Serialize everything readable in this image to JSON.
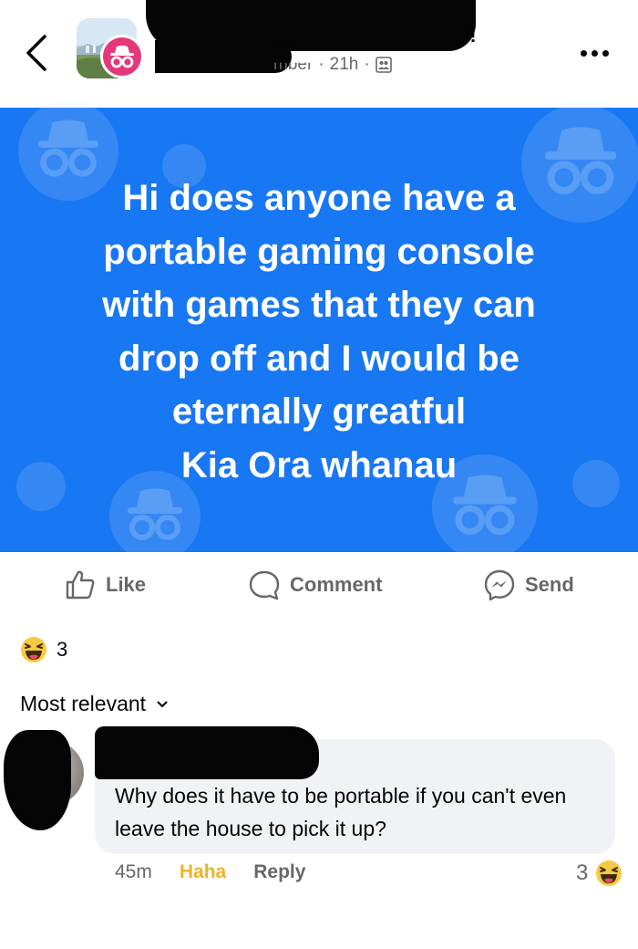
{
  "header": {
    "name_visible_fragment": "!!",
    "meta_fragment": "mber",
    "time": "21h",
    "separator": "·",
    "back_icon": "chevron-left-icon",
    "more_icon": "more-horizontal-icon",
    "privacy_icon": "members-icon"
  },
  "post": {
    "background_color": "#1877f2",
    "lines": [
      "Hi does anyone have a",
      "portable gaming console",
      "with games that they can",
      "drop off and I would be",
      "eternally greatful",
      "Kia Ora whanau"
    ]
  },
  "actions": {
    "like_label": "Like",
    "comment_label": "Comment",
    "send_label": "Send"
  },
  "reactions": {
    "type": "haha",
    "count": "3"
  },
  "comments": {
    "sort_label": "Most relevant",
    "items": [
      {
        "text": "Why does it have to be portable if you can't even leave the house to pick it up?",
        "time": "45m",
        "reaction_label": "Haha",
        "reply_label": "Reply",
        "reaction_count": "3",
        "reaction_type": "haha"
      }
    ]
  },
  "colors": {
    "accent": "#1877f2",
    "haha": "#e9b429",
    "secondary_text": "#65676b",
    "bubble": "#f0f2f5",
    "anon_badge": "#e4387a"
  }
}
